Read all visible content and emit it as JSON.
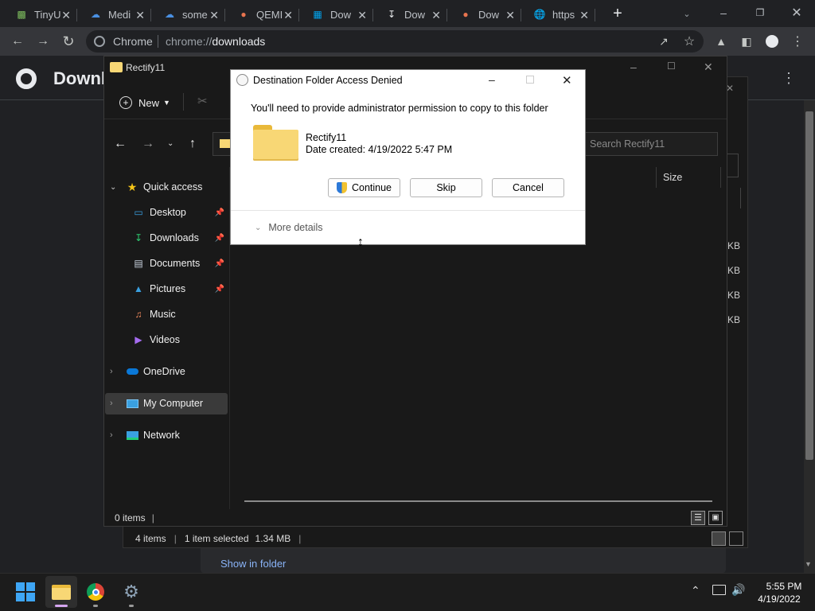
{
  "browser": {
    "tabs": [
      {
        "title": "TinyU",
        "icon": "pixel-art-icon",
        "color": "#7fbf5f"
      },
      {
        "title": "Medi",
        "icon": "cloud-icon",
        "color": "#4a90e2"
      },
      {
        "title": "some",
        "icon": "cloud-icon",
        "color": "#4a90e2"
      },
      {
        "title": "QEMI",
        "icon": "qemu-icon",
        "color": "#e8744f"
      },
      {
        "title": "Dow",
        "icon": "windows-logo-icon",
        "color": "#00a4ef"
      },
      {
        "title": "Dow",
        "icon": "download-icon",
        "color": "#e8eaed"
      },
      {
        "title": "Dow",
        "icon": "qemu-icon",
        "color": "#e8744f"
      },
      {
        "title": "https",
        "icon": "globe-icon",
        "color": "#bdc1c6"
      }
    ],
    "omnibox_site": "Chrome",
    "omnibox_url_prefix": "chrome://",
    "omnibox_url_page": "downloads",
    "page_title": "Downl",
    "show_in_folder": "Show in folder"
  },
  "explorer_back": {
    "status_items": "4 items",
    "status_selected": "1 item selected",
    "status_size": "1.34 MB",
    "size_partial": [
      "KB",
      "KB",
      "KB",
      "KB"
    ]
  },
  "explorer": {
    "title": "Rectify11",
    "new_label": "New",
    "search_placeholder": "Search Rectify11",
    "column_size": "Size",
    "status_items": "0 items",
    "nav": {
      "quick_access": "Quick access",
      "items": [
        {
          "label": "Desktop",
          "icon": "desktop-icon",
          "pinned": true
        },
        {
          "label": "Downloads",
          "icon": "download-arrow-icon",
          "pinned": true
        },
        {
          "label": "Documents",
          "icon": "document-icon",
          "pinned": true
        },
        {
          "label": "Pictures",
          "icon": "pictures-icon",
          "pinned": true
        },
        {
          "label": "Music",
          "icon": "music-icon",
          "pinned": false
        },
        {
          "label": "Videos",
          "icon": "videos-icon",
          "pinned": false
        }
      ],
      "onedrive": "OneDrive",
      "my_computer": "My Computer",
      "network": "Network"
    }
  },
  "dialog": {
    "title": "Destination Folder Access Denied",
    "message": "You'll need to provide administrator permission to copy to this folder",
    "folder_name": "Rectify11",
    "date_created": "Date created: 4/19/2022 5:47 PM",
    "continue_label": "Continue",
    "skip_label": "Skip",
    "cancel_label": "Cancel",
    "more_details": "More details"
  },
  "taskbar": {
    "time": "5:55 PM",
    "date": "4/19/2022"
  },
  "colors": {
    "accent_blue": "#0078d4",
    "folder_yellow": "#f8d775",
    "dark_bg": "#191919"
  }
}
